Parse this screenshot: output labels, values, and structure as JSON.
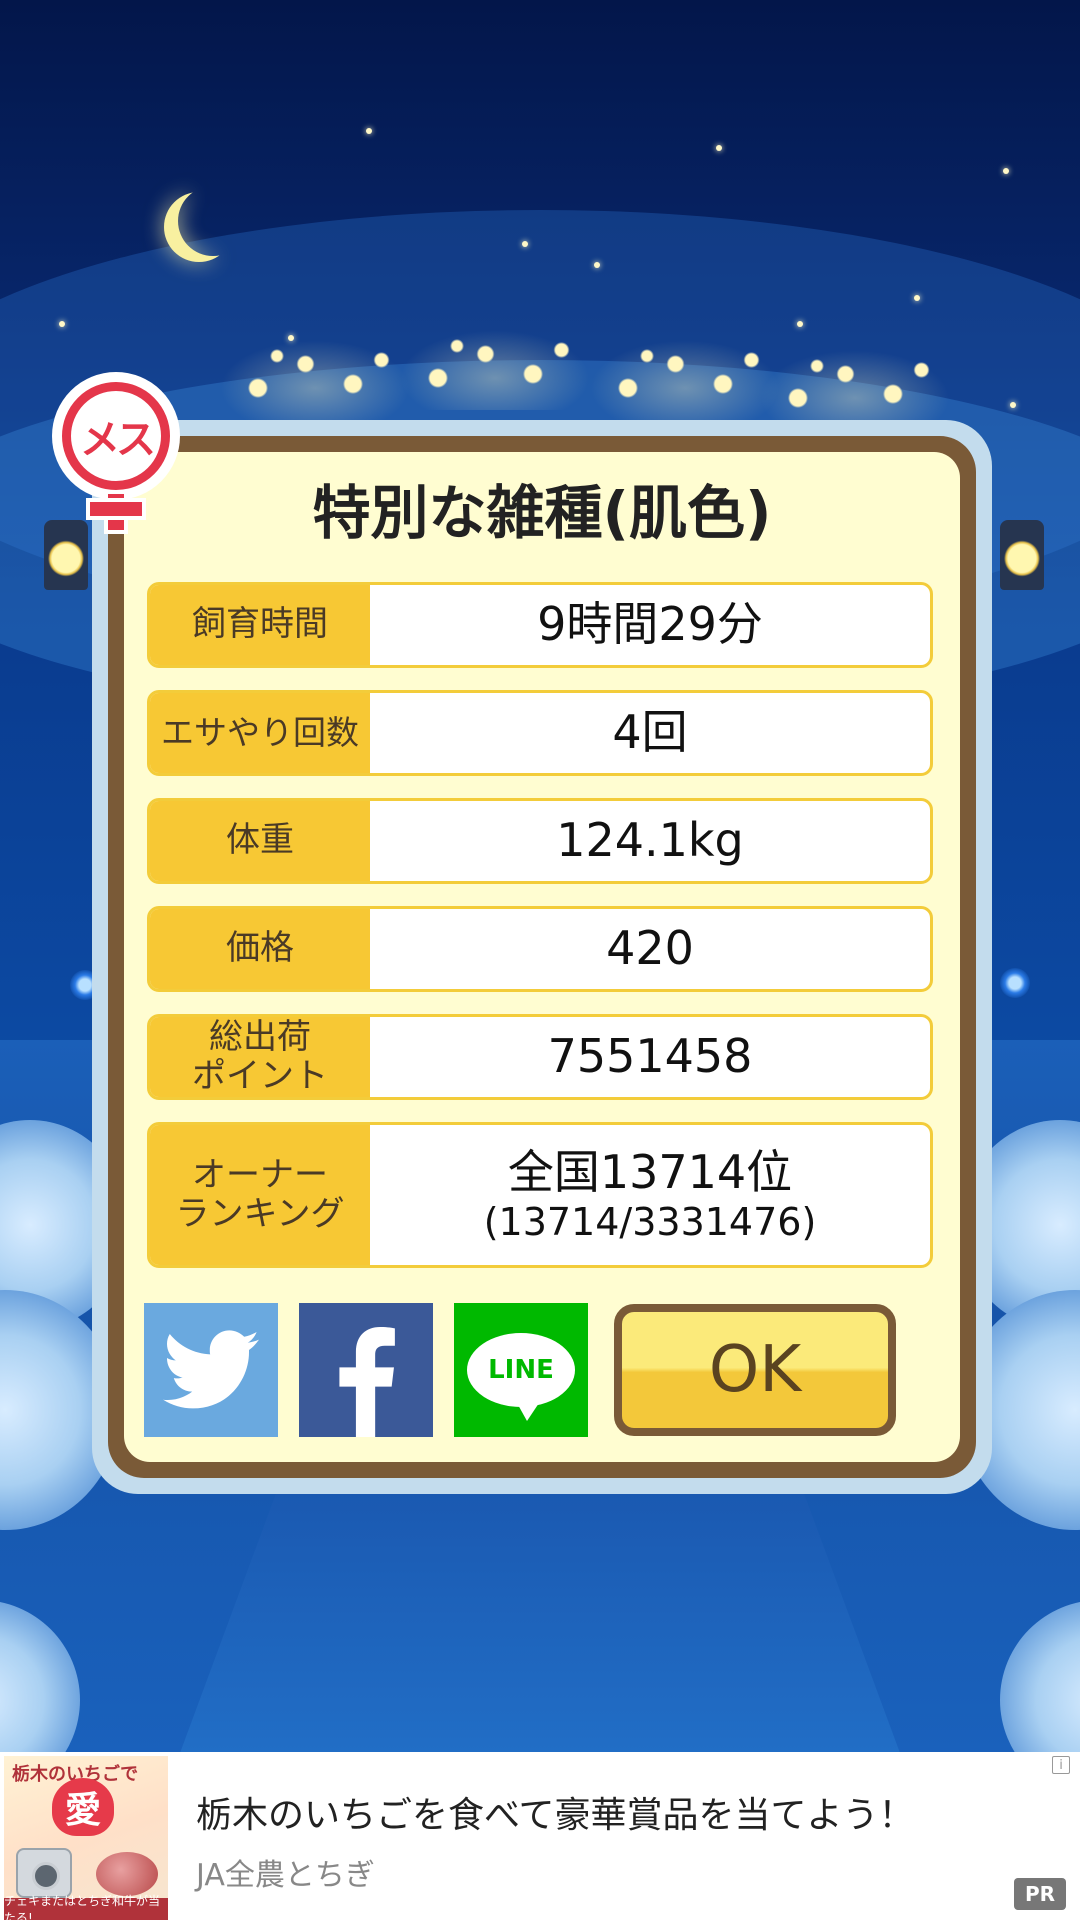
{
  "dialog": {
    "gender_badge": "メス",
    "title": "特別な雑種(肌色)",
    "rows": [
      {
        "label": "飼育時間",
        "value": "9時間29分"
      },
      {
        "label": "エサやり回数",
        "value": "4回"
      },
      {
        "label": "体重",
        "value": "124.1kg"
      },
      {
        "label": "価格",
        "value": "420"
      },
      {
        "label_line1": "総出荷",
        "label_line2": "ポイント",
        "value": "7551458"
      },
      {
        "label_line1": "オーナー",
        "label_line2": "ランキング",
        "value": "全国13714位",
        "value_sub": "(13714/3331476)"
      }
    ],
    "share": {
      "twitter_icon": "twitter-bird-icon",
      "facebook_label": "f",
      "line_label": "LINE"
    },
    "ok_label": "OK"
  },
  "ad": {
    "thumb_heading": "栃木のいちごで",
    "thumb_heart": "愛",
    "thumb_footer": "チェキまたはとちぎ和牛が当たる!",
    "title": "栃木のいちごを食べて豪華賞品を当てよう！",
    "sponsor": "JA全農とちぎ",
    "info_icon": "i",
    "pr_badge": "PR"
  },
  "colors": {
    "panel_bg": "#fffdd1",
    "frame": "#7a5a37",
    "label_bg": "#f7c834",
    "female_red": "#e4364a",
    "twitter": "#6aa9df",
    "facebook": "#3b5998",
    "line": "#00b900"
  }
}
